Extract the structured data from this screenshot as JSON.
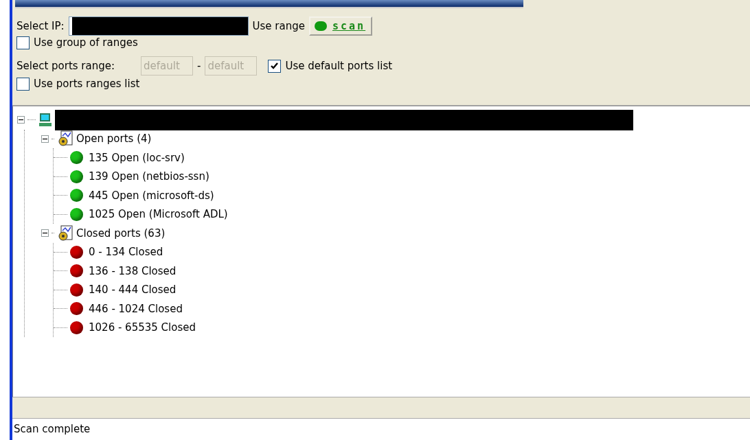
{
  "form": {
    "ip_label": "Select IP:",
    "use_range_label": "Use range",
    "scan_button": "scan",
    "group_ranges": {
      "label": "Use group of ranges",
      "checked": false
    },
    "ports_label": "Select ports range:",
    "port_from": {
      "placeholder": "default",
      "disabled": true
    },
    "dash": "-",
    "port_to": {
      "placeholder": "default",
      "disabled": true
    },
    "default_ports": {
      "label": "Use default ports list",
      "checked": true
    },
    "ranges_list": {
      "label": "Use ports ranges list",
      "checked": false
    }
  },
  "tree": {
    "root": {
      "expanded": true,
      "children": [
        {
          "label": "Open ports (4)",
          "expanded": true,
          "children": [
            {
              "label": "135 Open (loc-srv)",
              "color": "#19c219"
            },
            {
              "label": "139 Open (netbios-ssn)",
              "color": "#19c219"
            },
            {
              "label": "445 Open (microsoft-ds)",
              "color": "#19c219"
            },
            {
              "label": "1025 Open (Microsoft ADL)",
              "color": "#19c219"
            }
          ]
        },
        {
          "label": "Closed ports (63)",
          "expanded": true,
          "children": [
            {
              "label": "0 - 134 Closed",
              "color": "#cc0000"
            },
            {
              "label": "136 - 138 Closed",
              "color": "#cc0000"
            },
            {
              "label": "140 - 444 Closed",
              "color": "#cc0000"
            },
            {
              "label": "446 - 1024 Closed",
              "color": "#cc0000"
            },
            {
              "label": "1026 - 65535 Closed",
              "color": "#cc0000"
            }
          ]
        }
      ]
    }
  },
  "status_bar": "Scan complete"
}
